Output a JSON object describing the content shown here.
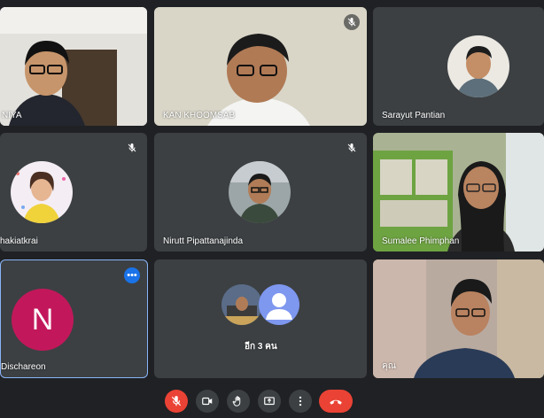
{
  "participants": [
    {
      "name": "NIYA"
    },
    {
      "name": "KAN KHOOMSAB"
    },
    {
      "name": "Sarayut Pantian"
    },
    {
      "name": "hakiatkrai"
    },
    {
      "name": "Nirutt Pipattanajinda"
    },
    {
      "name": "Sumalee Phimphan"
    },
    {
      "name": "Dischareon",
      "initial": "N"
    },
    {
      "name": "อีก 3 คน"
    },
    {
      "name": "คุณ"
    }
  ],
  "colors": {
    "background": "#202124",
    "tile": "#3c4043",
    "speaking_border": "#8ab4f8",
    "avatar_n": "#c2185b",
    "accent": "#1a73e8",
    "danger": "#ea4335"
  },
  "controls": [
    {
      "icon": "mic-off-icon",
      "state": "muted"
    },
    {
      "icon": "camera-icon"
    },
    {
      "icon": "raise-hand-icon"
    },
    {
      "icon": "present-screen-icon"
    },
    {
      "icon": "more-vert-icon"
    },
    {
      "icon": "end-call-icon"
    }
  ]
}
